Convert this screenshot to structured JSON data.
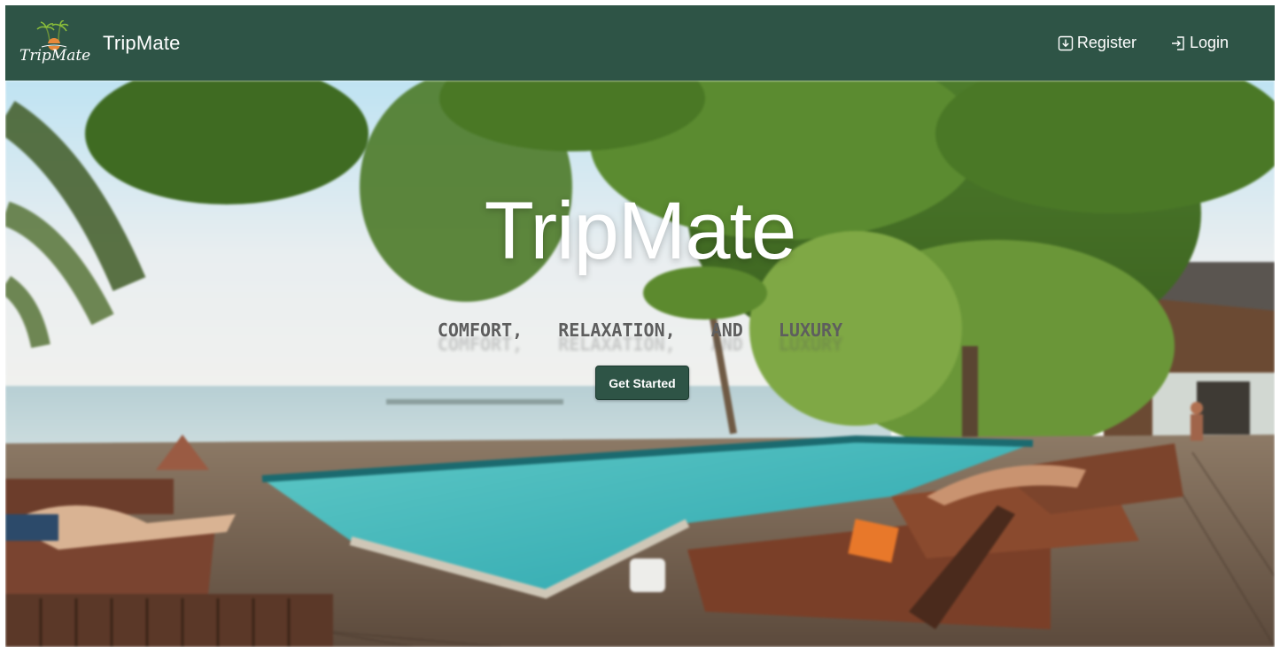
{
  "navbar": {
    "logo_icon": "tripmate-palm-logo-icon",
    "logo_text": "TripMate",
    "brand_name": "TripMate",
    "register_label": "Register",
    "register_icon": "download-box-icon",
    "login_label": "Login",
    "login_icon": "login-arrow-icon",
    "background_color": "#2e5446"
  },
  "hero": {
    "title": "TripMate",
    "tagline_words": [
      "COMFORT,",
      "RELAXATION,",
      "AND",
      "LUXURY"
    ],
    "cta_label": "Get Started",
    "cta_color": "#2e5446"
  }
}
